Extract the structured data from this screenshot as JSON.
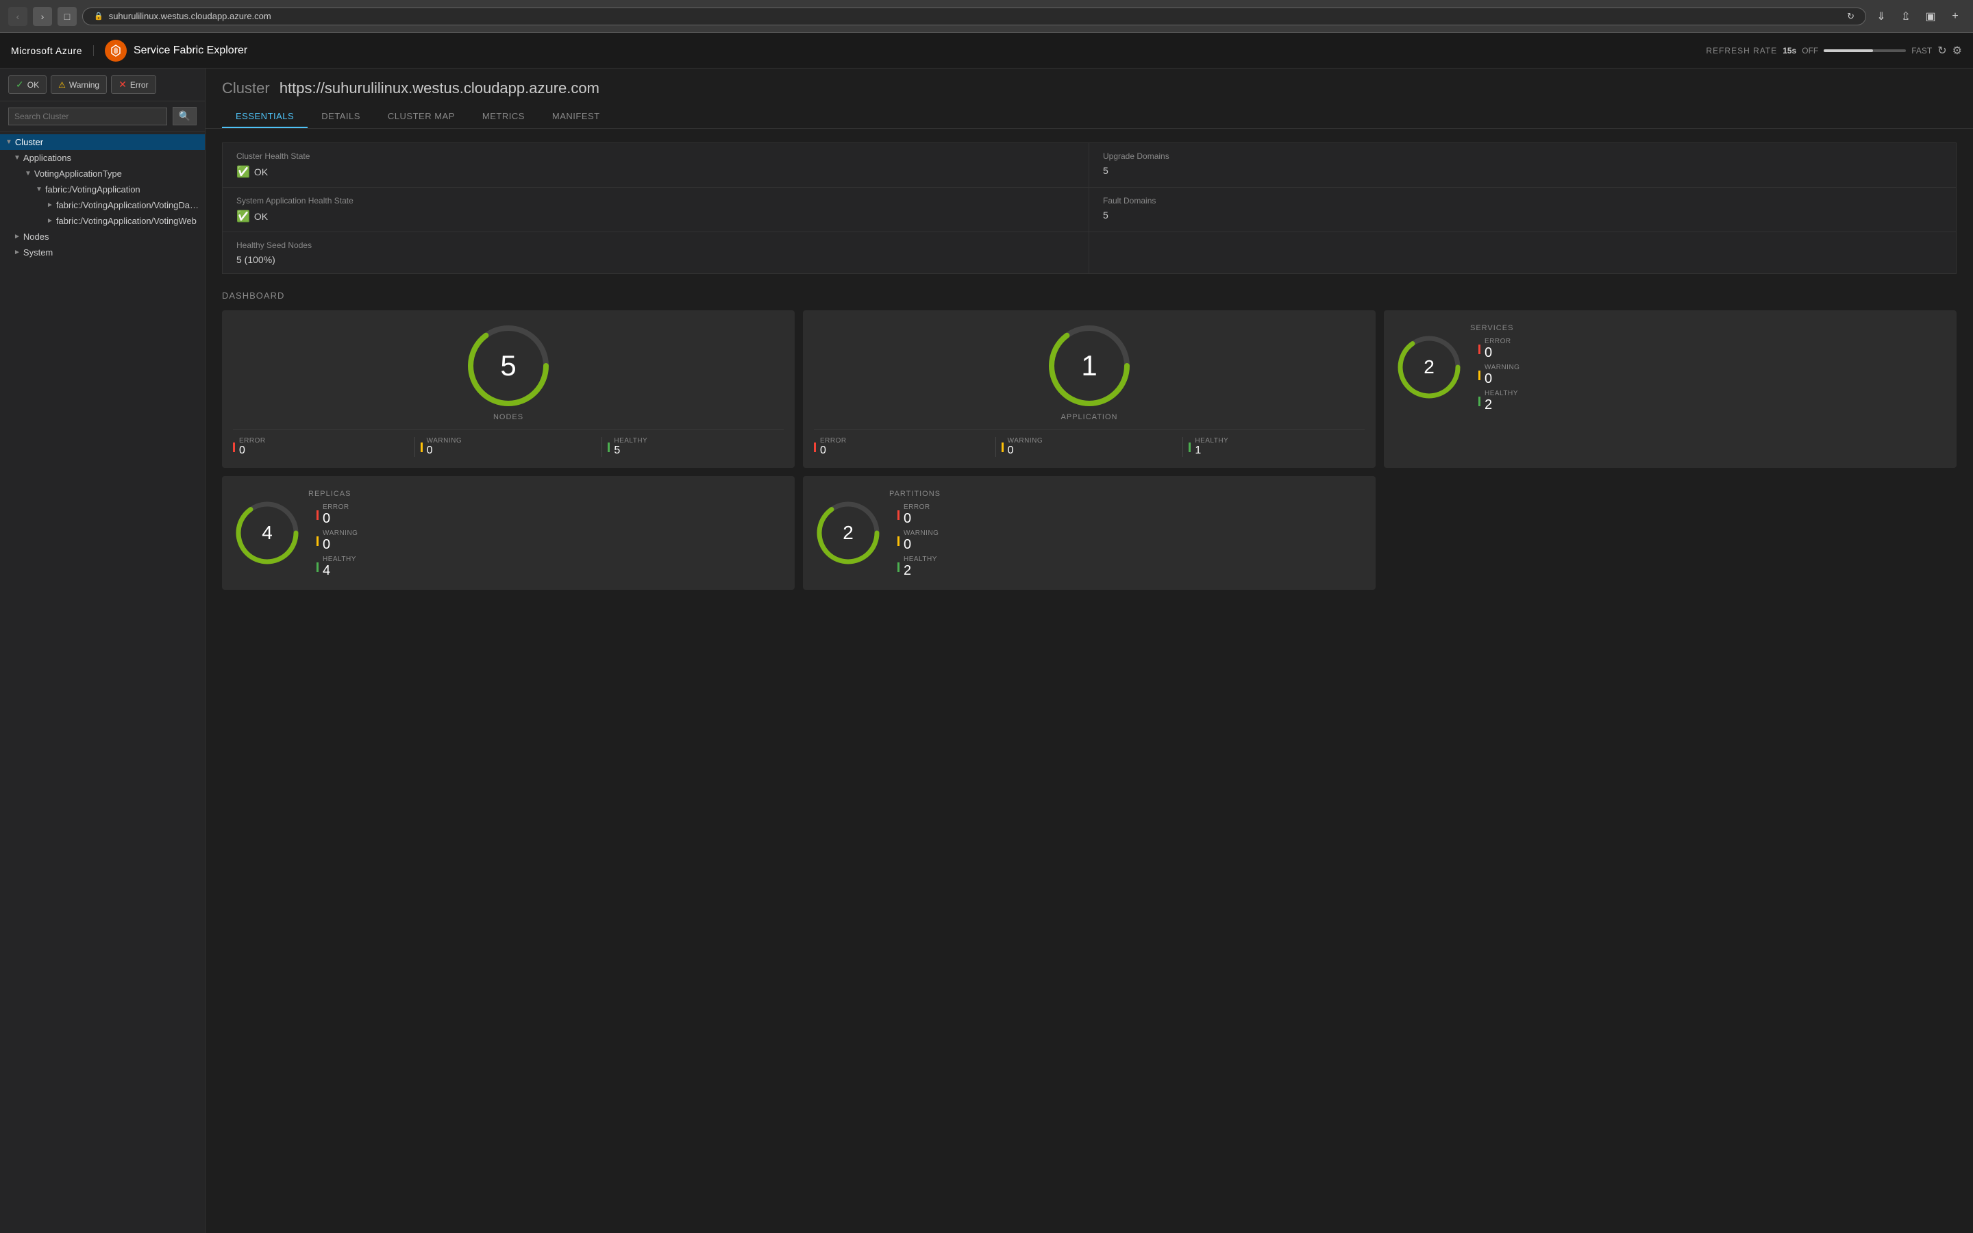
{
  "browser": {
    "url": "suhurulilinux.westus.cloudapp.azure.com",
    "url_display": "suhurulilinux.westus.cloudapp.azure.com"
  },
  "topbar": {
    "azure_label": "Microsoft Azure",
    "app_title": "Service Fabric Explorer",
    "refresh_rate_label": "REFRESH RATE",
    "refresh_seconds": "15s",
    "off_label": "OFF",
    "fast_label": "FAST"
  },
  "sidebar": {
    "filter_ok": "OK",
    "filter_warning": "Warning",
    "filter_error": "Error",
    "search_placeholder": "Search Cluster",
    "tree": [
      {
        "level": 0,
        "label": "Cluster",
        "expanded": true,
        "selected": true
      },
      {
        "level": 1,
        "label": "Applications",
        "expanded": true
      },
      {
        "level": 2,
        "label": "VotingApplicationType",
        "expanded": true
      },
      {
        "level": 3,
        "label": "fabric:/VotingApplication",
        "expanded": true
      },
      {
        "level": 4,
        "label": "fabric:/VotingApplication/VotingDataServ...",
        "expanded": false
      },
      {
        "level": 4,
        "label": "fabric:/VotingApplication/VotingWeb",
        "expanded": false
      },
      {
        "level": 1,
        "label": "Nodes",
        "expanded": false
      },
      {
        "level": 1,
        "label": "System",
        "expanded": false
      }
    ]
  },
  "content": {
    "cluster_word": "Cluster",
    "cluster_url": "https://suhurulilinux.westus.cloudapp.azure.com",
    "tabs": [
      "ESSENTIALS",
      "DETAILS",
      "CLUSTER MAP",
      "METRICS",
      "MANIFEST"
    ],
    "active_tab": "ESSENTIALS",
    "essentials": {
      "cluster_health_state_label": "Cluster Health State",
      "cluster_health_state_value": "OK",
      "system_app_health_label": "System Application Health State",
      "system_app_health_value": "OK",
      "healthy_seed_nodes_label": "Healthy Seed Nodes",
      "healthy_seed_nodes_value": "5 (100%)",
      "upgrade_domains_label": "Upgrade Domains",
      "upgrade_domains_value": "5",
      "fault_domains_label": "Fault Domains",
      "fault_domains_value": "5"
    },
    "dashboard_title": "DASHBOARD",
    "cards": [
      {
        "id": "nodes",
        "number": "5",
        "label": "NODES",
        "gauge_pct": 95,
        "error": 0,
        "warning": 0,
        "healthy": 5
      },
      {
        "id": "application",
        "number": "1",
        "label": "APPLICATION",
        "gauge_pct": 95,
        "error": 0,
        "warning": 0,
        "healthy": 1
      },
      {
        "id": "services",
        "number": "2",
        "label": "SERVICES",
        "gauge_pct": 95,
        "error": 0,
        "warning": 0,
        "healthy": 2
      },
      {
        "id": "partitions",
        "number": "2",
        "label": "PARTITIONS",
        "gauge_pct": 95,
        "error": 0,
        "warning": 0,
        "healthy": 2
      },
      {
        "id": "replicas",
        "number": "4",
        "label": "REPLICAS",
        "gauge_pct": 95,
        "error": 0,
        "warning": 0,
        "healthy": 4
      }
    ],
    "stat_labels": {
      "error": "ERROR",
      "warning": "WARNING",
      "healthy": "HEALTHY"
    }
  }
}
